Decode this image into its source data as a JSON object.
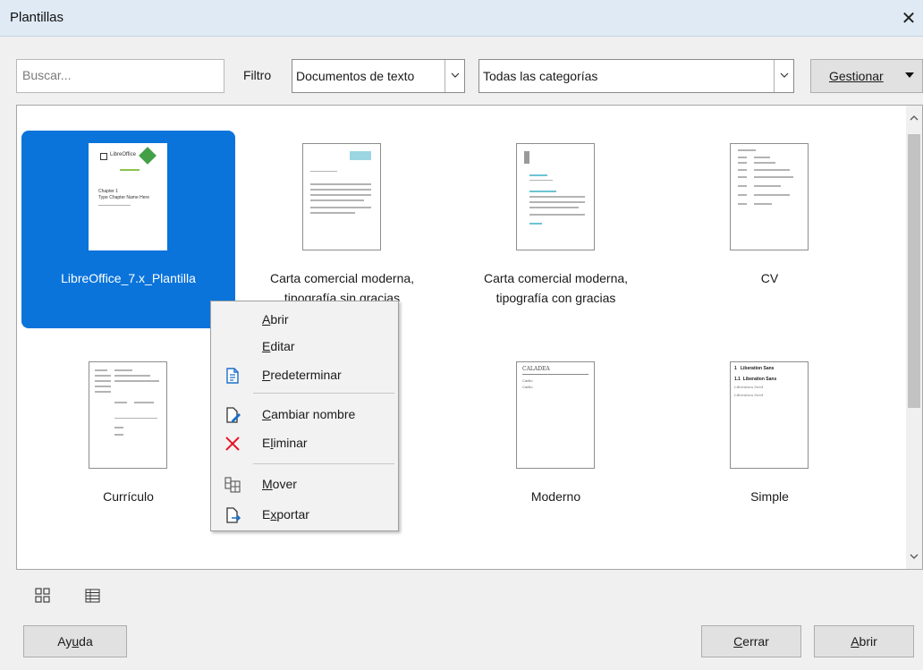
{
  "dialog": {
    "title": "Plantillas",
    "close_glyph": "✕"
  },
  "toolbar": {
    "search_placeholder": "Buscar...",
    "filter_label": "Filtro",
    "doc_type_value": "Documentos de texto",
    "category_value": "Todas las categorías",
    "manage_label": "Gestionar"
  },
  "templates": [
    {
      "name": "LibreOffice_7.x_Plantilla",
      "selected": true
    },
    {
      "name_line1": "Carta comercial moderna,",
      "name_line2": "tipografía sin gracias"
    },
    {
      "name_line1": "Carta comercial moderna,",
      "name_line2": "tipografía con gracias"
    },
    {
      "name": "CV"
    },
    {
      "name": "Currículo"
    },
    {
      "name": ""
    },
    {
      "name": "Moderno"
    },
    {
      "name": "Simple"
    }
  ],
  "thumbs": {
    "libreoffice": {
      "logo": "LibreOffice",
      "line1": "Chapter 1",
      "line2": "Type Chapter Name Here"
    },
    "moderno": {
      "heading": "CALADEA",
      "l1": "Carlito",
      "l2": "Carlito"
    },
    "simple": {
      "h1": "1   Liberation Sans",
      "h2": "1.1  Liberation Sans",
      "l1": "Liberation Serif",
      "l2": "Liberation Serif"
    }
  },
  "context_menu": {
    "open": {
      "accel": "A",
      "rest": "brir"
    },
    "edit": {
      "accel": "E",
      "rest": "ditar"
    },
    "default": {
      "accel": "P",
      "rest": "redeterminar"
    },
    "rename": {
      "accel": "C",
      "rest": "ambiar nombre"
    },
    "delete": {
      "pre": "E",
      "accel": "l",
      "rest": "iminar"
    },
    "move": {
      "accel": "M",
      "rest": "over"
    },
    "export": {
      "pre": "E",
      "accel": "x",
      "rest": "portar"
    }
  },
  "footer": {
    "help": {
      "pre": "Ay",
      "accel": "u",
      "rest": "da"
    },
    "close": {
      "accel": "C",
      "rest": "errar"
    },
    "open": {
      "accel": "A",
      "rest": "brir"
    }
  },
  "colors": {
    "selection": "#0a74db",
    "delete_icon": "#e81123",
    "icon_blue": "#1a6fc9"
  },
  "icons": [
    "close-icon",
    "chevron-down-icon",
    "dropdown-triangle-icon",
    "thumbnail-view-icon",
    "list-view-icon",
    "set-default-icon",
    "rename-icon",
    "delete-icon",
    "move-icon",
    "export-icon"
  ]
}
